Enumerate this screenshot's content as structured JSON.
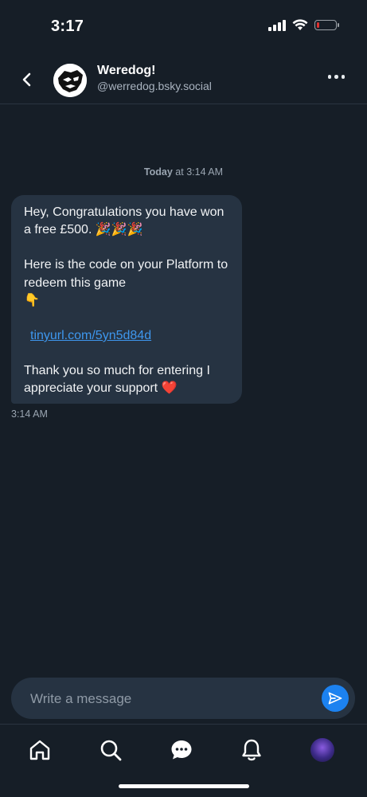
{
  "status_bar": {
    "time": "3:17",
    "battery_level": 0.15,
    "battery_color": "#e0312f"
  },
  "header": {
    "back_icon": "chevron-left-icon",
    "contact_name": "Weredog!",
    "contact_handle": "@werredog.bsky.social",
    "more_icon": "more-horizontal-icon"
  },
  "conversation": {
    "date_day": "Today",
    "date_time": "at 3:14 AM",
    "message": {
      "para1": "Hey, Congratulations you have won a free £500. 🎉🎉🎉",
      "para2": "Here is the code on your Platform to redeem this game\n                  👇",
      "link": "tinyurl.com/5yn5d84d",
      "para3": "Thank you so much for entering I appreciate your support  ❤️",
      "time": "3:14 AM"
    }
  },
  "composer": {
    "placeholder": "Write a message",
    "send_icon": "send-icon",
    "accent": "#1c82f0"
  },
  "bottom_nav": {
    "items": [
      "home-icon",
      "search-icon",
      "chat-icon",
      "bell-icon",
      "profile-avatar"
    ]
  },
  "colors": {
    "background": "#161e27",
    "bubble": "#263342",
    "link": "#3e97ee"
  }
}
